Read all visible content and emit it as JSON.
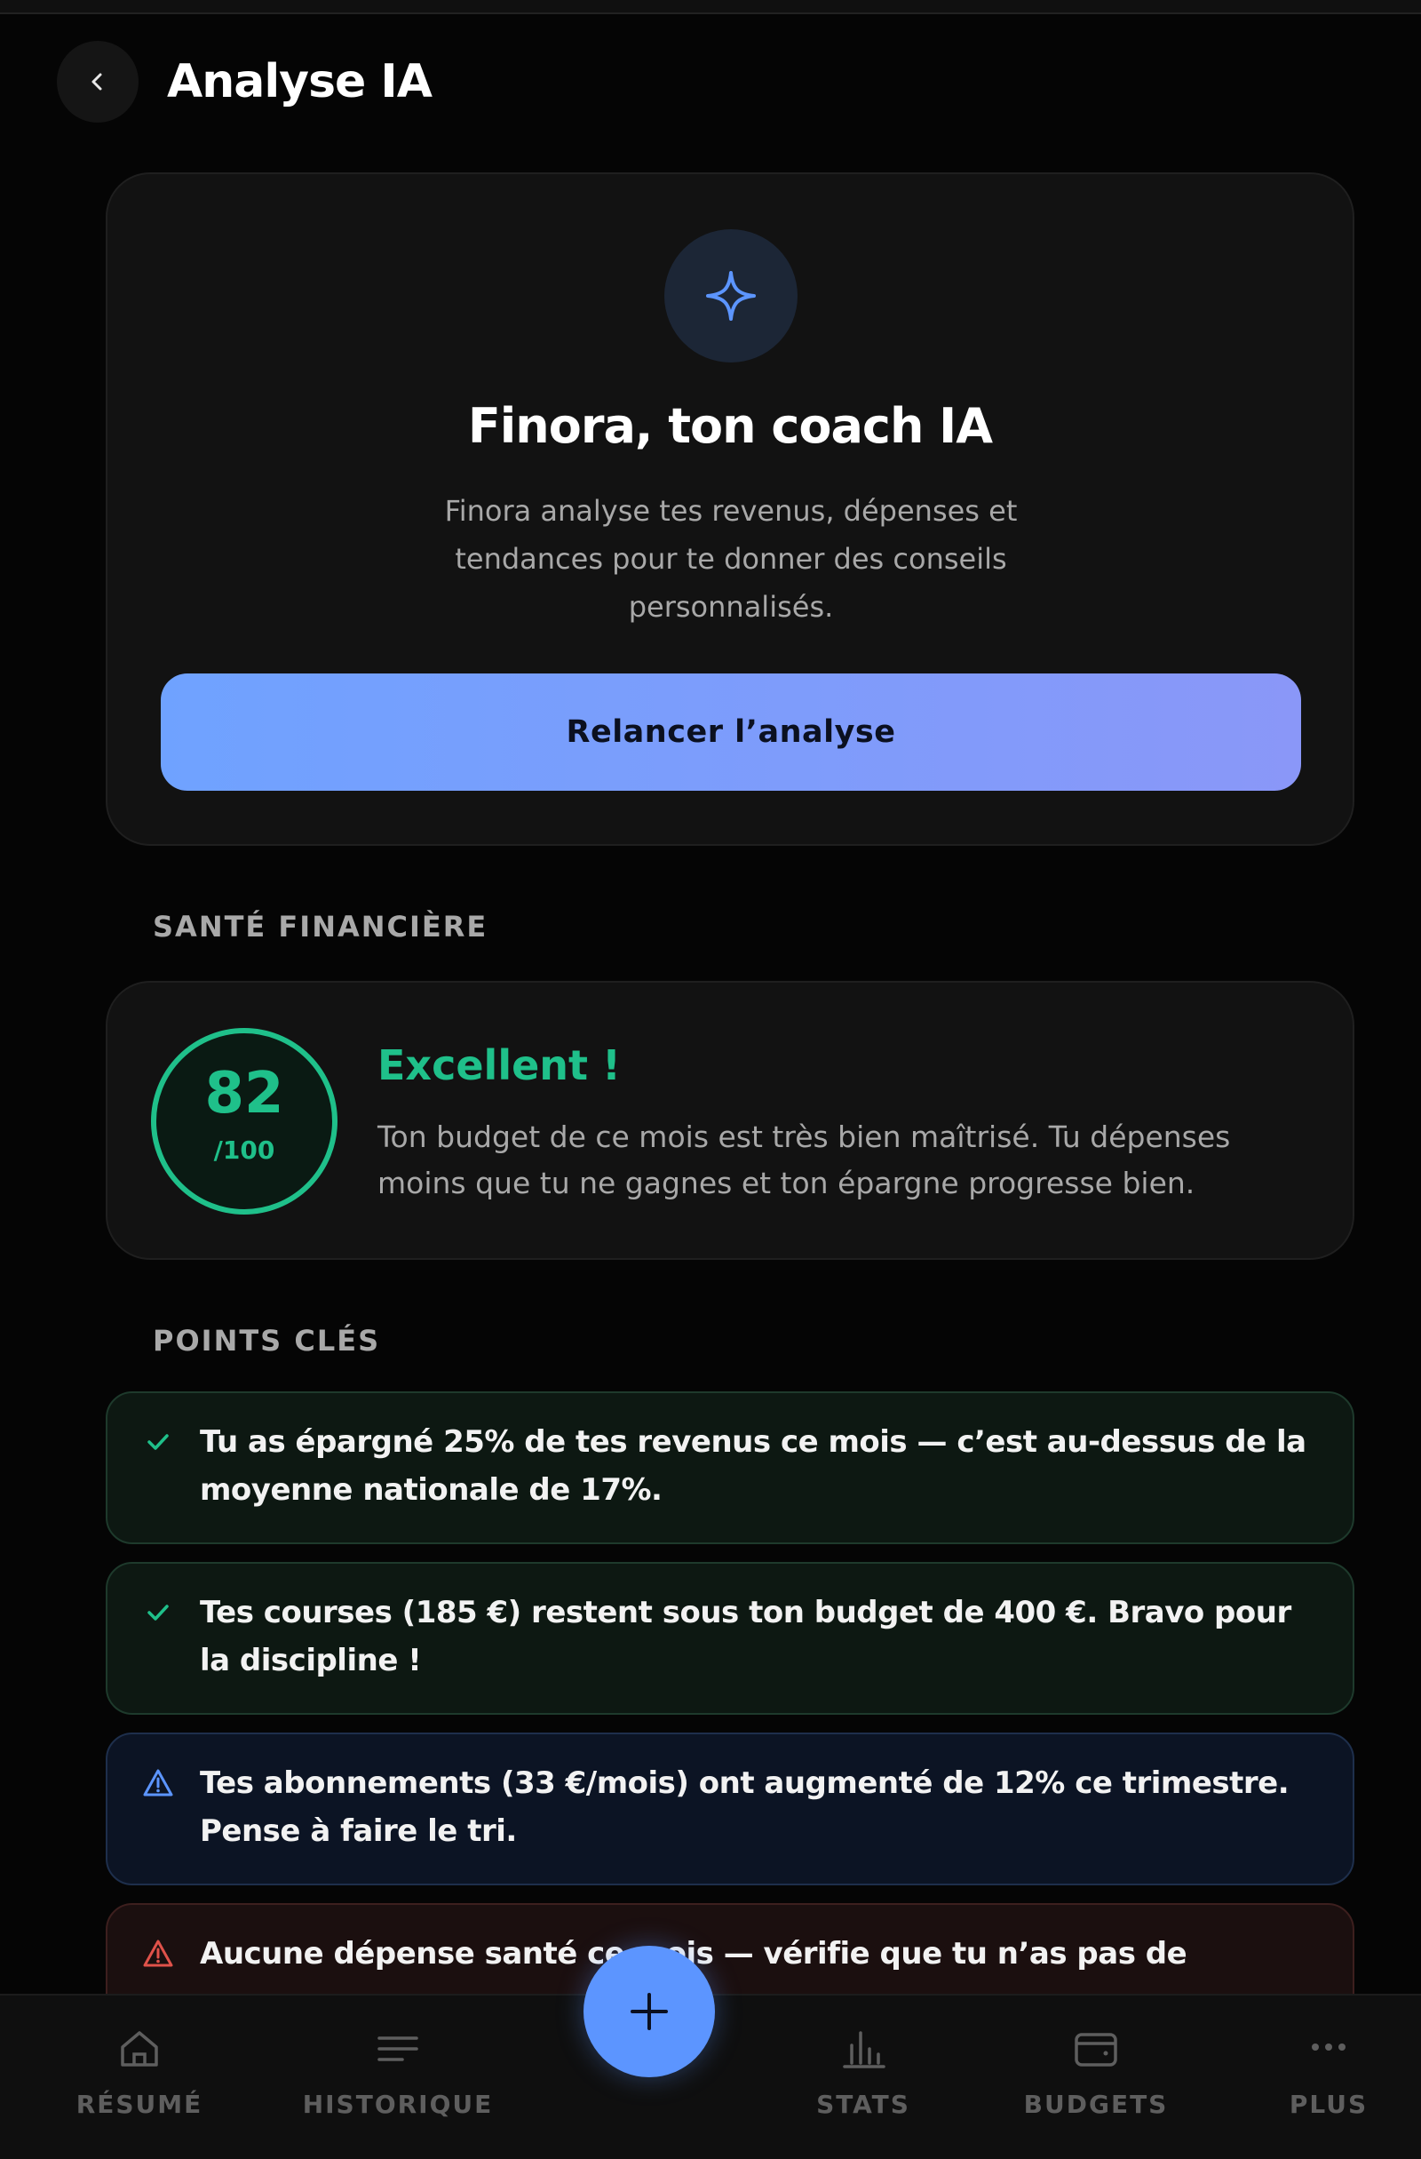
{
  "header": {
    "title": "Analyse IA",
    "back_icon": "chevron-left-icon"
  },
  "hero": {
    "icon": "sparkle-icon",
    "title": "Finora, ton coach IA",
    "description": "Finora analyse tes revenus, dépenses et tendances pour te donner des conseils personnalisés.",
    "button_label": "Relancer l’analyse"
  },
  "health": {
    "section_label": "SANTÉ FINANCIÈRE",
    "score": "82",
    "score_max": "/100",
    "score_value": 0.82,
    "status": "Excellent !",
    "description": "Ton budget de ce mois est très bien maîtrisé. Tu dépenses moins que tu ne gagnes et ton épargne progresse bien."
  },
  "key_points": {
    "section_label": "POINTS CLÉS",
    "items": [
      {
        "type": "good",
        "icon": "check-icon",
        "text": "Tu as épargné 25% de tes revenus ce mois — c’est au-dessus de la moyenne nationale de 17%."
      },
      {
        "type": "good",
        "icon": "check-icon",
        "text": "Tes courses (185 €) restent sous ton budget de 400 €. Bravo pour la discipline !"
      },
      {
        "type": "info",
        "icon": "warning-triangle-icon",
        "text": "Tes abonnements (33 €/mois) ont augmenté de 12% ce trimestre. Pense à faire le tri."
      },
      {
        "type": "warn",
        "icon": "warning-triangle-icon",
        "text": "Aucune dépense santé ce mois — vérifie que tu n’as pas de"
      }
    ]
  },
  "nav": {
    "items": [
      {
        "label": "RÉSUMÉ",
        "icon": "home-icon"
      },
      {
        "label": "HISTORIQUE",
        "icon": "list-icon"
      },
      {
        "label": "STATS",
        "icon": "bar-chart-icon"
      },
      {
        "label": "BUDGETS",
        "icon": "wallet-icon"
      },
      {
        "label": "PLUS",
        "icon": "more-dots-icon"
      }
    ],
    "fab_icon": "plus-icon"
  },
  "colors": {
    "accent": "#6fa2ff",
    "success": "#1fc08a",
    "info": "#5c95ff",
    "danger": "#e0524a"
  }
}
